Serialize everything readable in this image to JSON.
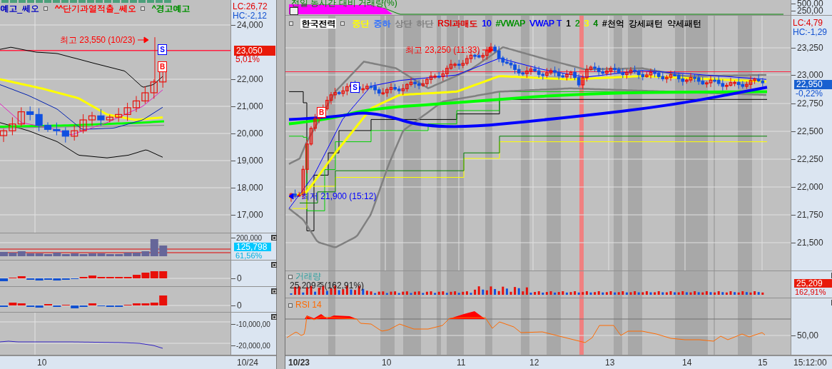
{
  "left_chart": {
    "legend": [
      {
        "label": "예고_쎄오",
        "color": "#0000c0"
      },
      {
        "label": "^^단기과열적출_쎄오",
        "color": "#ff0000"
      },
      {
        "label": "^경고예고",
        "color": "#009000"
      }
    ],
    "lc": "LC:26,72",
    "hc": "HC:-2,12",
    "high_label": "최고 23,550 (10/23)",
    "signals": [
      {
        "label": "S",
        "kind": "sell"
      },
      {
        "label": "B",
        "kind": "buy"
      }
    ],
    "price_ticks": [
      "24,000",
      "22,000",
      "21,000",
      "20,000",
      "19,000",
      "18,000",
      "17,000"
    ],
    "price_box": "23,050",
    "price_change": "5,01%",
    "volume": {
      "tick": "200,000",
      "value": "125,798",
      "ratio": "61,56%"
    },
    "pane_2": {
      "tick": "0"
    },
    "pane_3": {
      "tick": "0"
    },
    "pane_4": {
      "ticks": [
        "-10,000,00",
        "-20,000,00"
      ]
    },
    "x_labels": [
      "10"
    ],
    "x_end": "10/24"
  },
  "right_chart": {
    "top_pane": {
      "title": "전일 동시간 대비 거래량(%)",
      "ticks": [
        "500,00",
        "250,00"
      ]
    },
    "legend": [
      {
        "label": "한국전력",
        "color": "#000000"
      },
      {
        "label": "중단",
        "color": "#ffff00"
      },
      {
        "label": "중하",
        "color": "#3070ff"
      },
      {
        "label": "상단",
        "color": "#808080"
      },
      {
        "label": "하단",
        "color": "#808080"
      },
      {
        "label": "RSI과매도",
        "color": "#e00000"
      },
      {
        "label": "10",
        "color": "#0000ff"
      },
      {
        "label": "#VWAP",
        "color": "#009000"
      },
      {
        "label": "VWAP T",
        "color": "#0000ff"
      },
      {
        "label": "1",
        "color": "#000000"
      },
      {
        "label": "2",
        "color": "#009000"
      },
      {
        "label": "3",
        "color": "#ffff00"
      },
      {
        "label": "4",
        "color": "#008000"
      },
      {
        "label": "#천억",
        "color": "#000000"
      },
      {
        "label": "강세패턴",
        "color": "#000000"
      },
      {
        "label": "약세패턴",
        "color": "#000000"
      }
    ],
    "lc": "LC:4,79",
    "hc": "HC:-1,29",
    "high_label": "최고 23,250 (11:33)",
    "low_label": "최저 21,900 (15:12)",
    "signals": [
      {
        "label": "S",
        "kind": "sell"
      },
      {
        "label": "B",
        "kind": "buy"
      }
    ],
    "price_ticks": [
      "23,250",
      "23,000",
      "22,750",
      "22,500",
      "22,250",
      "22,000",
      "21,750",
      "21,500"
    ],
    "price_box": "22,950",
    "price_change": "-0,22%",
    "volume": {
      "title": "거래량",
      "reading": "25,209주(162,91%)",
      "value": "25,209",
      "ratio": "162,91%"
    },
    "rsi": {
      "title": "RSI 14",
      "tick": "50,00"
    },
    "x_labels": [
      "10/23",
      "10",
      "11",
      "12",
      "13",
      "14",
      "15"
    ],
    "time": "15:12:00"
  }
}
